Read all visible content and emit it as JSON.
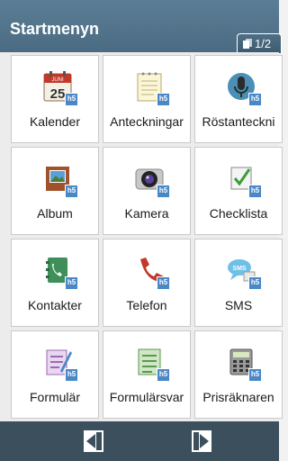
{
  "header": {
    "title": "Startmenyn",
    "page_indicator": "1/2"
  },
  "apps": [
    {
      "label": "Kalender",
      "icon": "calendar-icon"
    },
    {
      "label": "Anteckningar",
      "icon": "notes-icon"
    },
    {
      "label": "Röstanteckni",
      "icon": "microphone-icon"
    },
    {
      "label": "Album",
      "icon": "photo-album-icon"
    },
    {
      "label": "Kamera",
      "icon": "camera-icon"
    },
    {
      "label": "Checklista",
      "icon": "checklist-icon"
    },
    {
      "label": "Kontakter",
      "icon": "contacts-book-icon"
    },
    {
      "label": "Telefon",
      "icon": "phone-handset-icon"
    },
    {
      "label": "SMS",
      "icon": "sms-bubble-icon"
    },
    {
      "label": "Formulär",
      "icon": "form-icon"
    },
    {
      "label": "Formulärsvar",
      "icon": "form-answers-icon"
    },
    {
      "label": "Prisräknaren",
      "icon": "calculator-icon"
    }
  ],
  "calendar_icon": {
    "month": "JUNI",
    "day": "25"
  },
  "badge_text": "h5",
  "colors": {
    "header": "#4f7088",
    "bottom_bar": "#3c4f5d",
    "badge": "#4a87c6"
  },
  "bottom_nav": {
    "prev": "arrow-left-icon",
    "next": "arrow-right-icon"
  }
}
